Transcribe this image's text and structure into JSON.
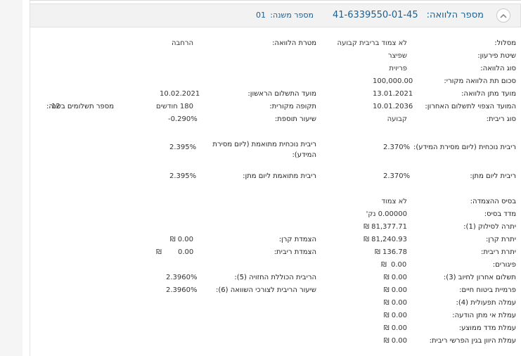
{
  "header": {
    "loan_number_label": "מספר הלוואה:",
    "loan_number": "41-6339550-01-45",
    "sub_number_label": "מספר משנה:",
    "sub_number": "01"
  },
  "fields": {
    "track_label": "מסלול:",
    "track_value": "לא צמוד בריבית קבועה",
    "loan_purpose_label": "מטרת הלוואה:",
    "loan_purpose_value": "הרחבה",
    "repayment_method_label": "שיטת פירעון:",
    "repayment_method_value": "שפיצר",
    "loan_type_label": "סוג הלוואה:",
    "loan_type_value": "פריוית",
    "original_amount_label": "סכום תת הלוואה מקורי:",
    "original_amount_value": "100,000.00",
    "grant_date_label": "מועד מתן הלוואה:",
    "grant_date_value": "13.01.2021",
    "first_payment_label": "מועד התשלום הראשון:",
    "first_payment_value": "10.02.2021",
    "last_payment_label": "המועד הצפוי לתשלום האחרון:",
    "last_payment_value": "10.01.2036",
    "original_period_label": "תקופה מקורית:",
    "original_period_value": "180 חודשים",
    "payments_per_year_label": "מספר תשלומים בשנה:",
    "payments_per_year_value": "12",
    "interest_type_label": "סוג ריבית:",
    "interest_type_value": "קבועה",
    "additional_rate_label": "שיעור תוספת:",
    "additional_rate_value": "-0.290%",
    "current_rate_label": "ריבית נוכחית (ליום מסירת המידע):",
    "current_rate_value": "2.370%",
    "current_adjusted_label": "ריבית נוכחית מתואמת (ליום מסירת המידע):",
    "current_adjusted_value": "2.395%",
    "grant_day_rate_label": "ריבית ליום מתן:",
    "grant_day_rate_value": "2.370%",
    "grant_day_adjusted_label": "ריבית מתואמת ליום מתן:",
    "grant_day_adjusted_value": "2.395%",
    "indexation_basis_label": "בסיס ההצמדה:",
    "indexation_basis_value": "לא צמוד",
    "base_index_label": "מדד בסיס:",
    "base_index_value": "0.00000 נק'",
    "payoff_balance_label": "יתרה לסילוק (1):",
    "payoff_balance_value": "81,377.71 ₪",
    "principal_balance_label": "יתרת קרן:",
    "principal_balance_value": "81,240.93 ₪",
    "principal_indexation_label": "הצמדת קרן:",
    "principal_indexation_value": "0.00 ₪",
    "interest_balance_label": "יתרת ריבית:",
    "interest_balance_value": "136.78 ₪",
    "interest_indexation_label": "הצמדת ריבית:",
    "interest_indexation_amount": "0.00",
    "interest_indexation_currency": "₪",
    "arrears_label": "פיגורים:",
    "arrears_amount": "0.00",
    "arrears_currency": "₪",
    "last_charge_label": "תשלום אחרון לחיוב (3):",
    "last_charge_value": "0.00 ₪",
    "total_expected_rate_label": "הריבית הכוללת החזויה (5):",
    "total_expected_rate_value": "2.3960%",
    "life_insurance_label": "פרמיית ביטוח חיים:",
    "life_insurance_value": "0.00 ₪",
    "comparison_rate_label": "שיעור הריבית לצורכי השוואה (6):",
    "comparison_rate_value": "2.3960%",
    "operational_fee_label": "עמלה תפעולית (4):",
    "operational_fee_value": "0.00 ₪",
    "no_notice_fee_label": "עמלת אי מתן הודעה:",
    "no_notice_fee_value": "0.00 ₪",
    "avg_index_fee_label": "עמלת מדד ממוצע:",
    "avg_index_fee_value": "0.00 ₪",
    "interest_diff_fee_label": "עמלת היוון בגין הפרשי ריבית:",
    "interest_diff_fee_value": "0.00 ₪"
  }
}
